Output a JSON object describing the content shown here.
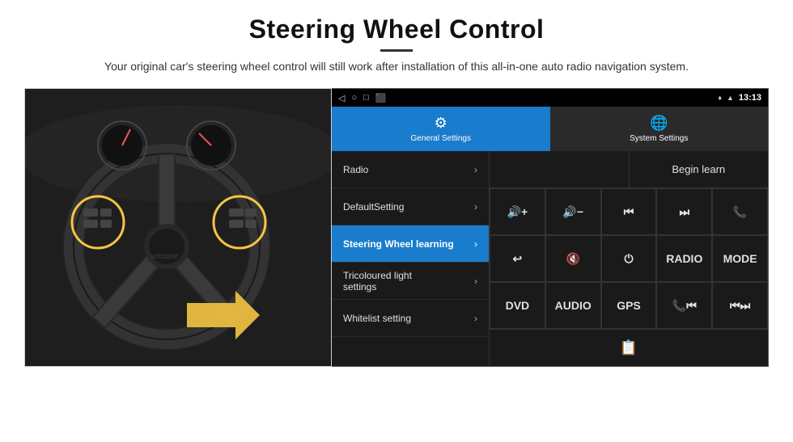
{
  "header": {
    "title": "Steering Wheel Control",
    "subtitle": "Your original car's steering wheel control will still work after installation of this all-in-one auto radio navigation system."
  },
  "status_bar": {
    "time": "13:13",
    "icons": [
      "◁",
      "○",
      "□",
      "⬛"
    ]
  },
  "tabs": [
    {
      "label": "General Settings",
      "active": true
    },
    {
      "label": "System Settings",
      "active": false
    }
  ],
  "menu_items": [
    {
      "label": "Radio",
      "active": false
    },
    {
      "label": "DefaultSetting",
      "active": false
    },
    {
      "label": "Steering Wheel learning",
      "active": true
    },
    {
      "label": "Tricoloured light settings",
      "active": false
    },
    {
      "label": "Whitelist setting",
      "active": false
    }
  ],
  "begin_learn": "Begin learn",
  "control_buttons": [
    {
      "label": "🔊+",
      "type": "icon"
    },
    {
      "label": "🔊-",
      "type": "icon"
    },
    {
      "label": "⏮",
      "type": "icon"
    },
    {
      "label": "⏭",
      "type": "icon"
    },
    {
      "label": "📞",
      "type": "icon"
    },
    {
      "label": "↩",
      "type": "icon"
    },
    {
      "label": "🔇",
      "type": "icon"
    },
    {
      "label": "⏻",
      "type": "icon"
    },
    {
      "label": "RADIO",
      "type": "text"
    },
    {
      "label": "MODE",
      "type": "text"
    },
    {
      "label": "DVD",
      "type": "text"
    },
    {
      "label": "AUDIO",
      "type": "text"
    },
    {
      "label": "GPS",
      "type": "text"
    },
    {
      "label": "📞⏮",
      "type": "icon"
    },
    {
      "label": "⏮⏭",
      "type": "icon"
    }
  ]
}
